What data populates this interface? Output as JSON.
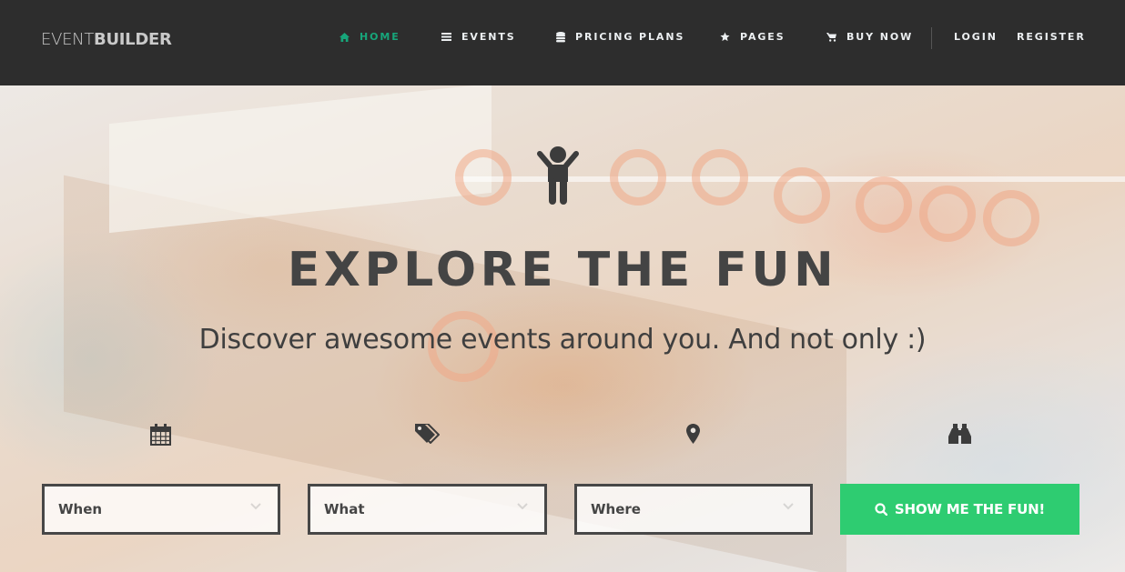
{
  "brand": {
    "light": "EVENT",
    "bold": "BUILDER"
  },
  "nav": {
    "items": [
      {
        "label": "HOME",
        "icon": "home-icon",
        "active": true
      },
      {
        "label": "EVENTS",
        "icon": "list-icon",
        "active": false
      },
      {
        "label": "PRICING PLANS",
        "icon": "database-icon",
        "active": false
      },
      {
        "label": "PAGES",
        "icon": "star-icon",
        "active": false
      },
      {
        "label": "BUY NOW",
        "icon": "cart-icon",
        "active": false
      }
    ],
    "auth": {
      "login": "LOGIN",
      "register": "REGISTER"
    }
  },
  "hero": {
    "icon": "child-icon",
    "title": "EXPLORE THE FUN",
    "subtitle": "Discover awesome events around you. And not only :)"
  },
  "search": {
    "fields": [
      {
        "label": "When",
        "icon": "calendar-icon"
      },
      {
        "label": "What",
        "icon": "tags-icon"
      },
      {
        "label": "Where",
        "icon": "map-marker-icon"
      }
    ],
    "button": {
      "label": "SHOW ME THE FUN!",
      "icon": "search-icon",
      "top_icon": "binoculars-icon"
    }
  },
  "colors": {
    "accent": "#17a57a",
    "button": "#2ecc71",
    "header_bg": "#2d2d2d",
    "text_dark": "#444444"
  }
}
